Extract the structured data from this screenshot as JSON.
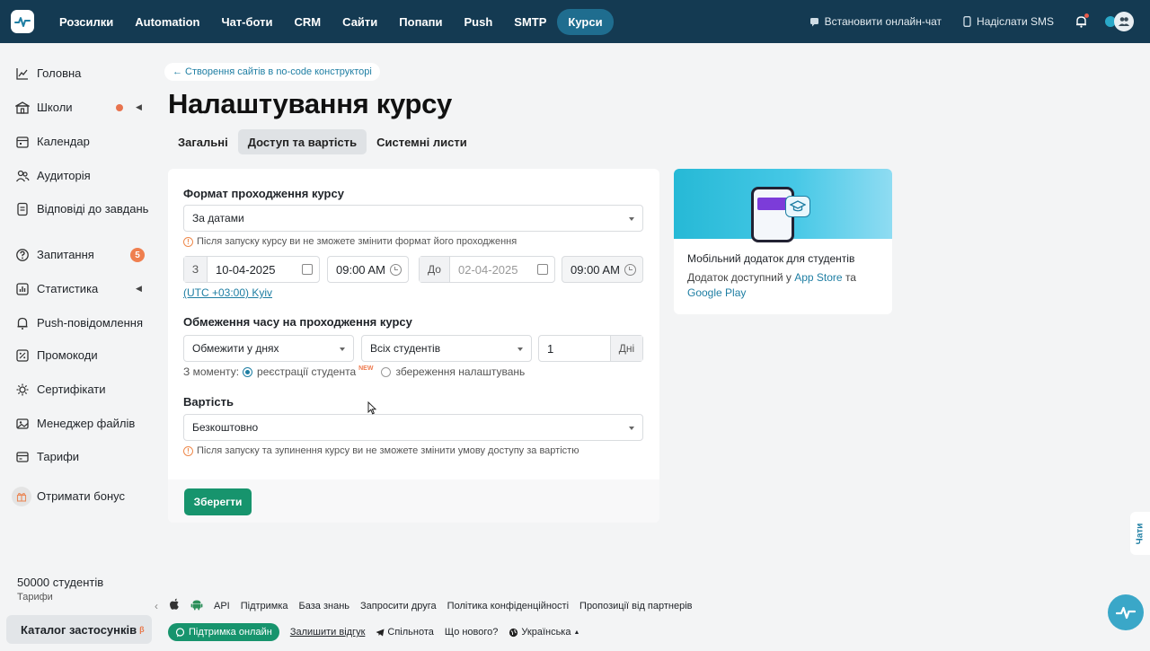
{
  "topnav": {
    "items": [
      "Розсилки",
      "Automation",
      "Чат-боти",
      "CRM",
      "Сайти",
      "Попапи",
      "Push",
      "SMTP",
      "Курси"
    ],
    "active": "Курси",
    "install_chat": "Встановити онлайн-чат",
    "send_sms": "Надіслати SMS"
  },
  "sidebar": {
    "items": [
      {
        "label": "Головна",
        "icon": "chart-line-icon"
      },
      {
        "label": "Школи",
        "icon": "school-icon"
      },
      {
        "label": "Календар",
        "icon": "calendar-icon"
      },
      {
        "label": "Аудиторія",
        "icon": "users-icon"
      },
      {
        "label": "Відповіді до завдань",
        "icon": "answers-icon"
      },
      {
        "label": "Запитання",
        "icon": "question-icon",
        "badge": "5"
      },
      {
        "label": "Статистика",
        "icon": "stats-icon"
      },
      {
        "label": "Push-повідомлення",
        "icon": "bell-icon"
      },
      {
        "label": "Промокоди",
        "icon": "promo-icon"
      },
      {
        "label": "Сертифікати",
        "icon": "certificate-icon"
      },
      {
        "label": "Менеджер файлів",
        "icon": "files-icon"
      },
      {
        "label": "Тарифи",
        "icon": "tariff-icon"
      },
      {
        "label": "Отримати бонус",
        "icon": "gift-icon"
      }
    ],
    "students": "50000 студентів",
    "tariffs_link": "Тарифи",
    "catalog": "Каталог застосунків",
    "catalog_badge": "β"
  },
  "breadcrumb": "← Створення сайтів в no-code конструкторі",
  "page_title": "Налаштування курсу",
  "tabs": [
    "Загальні",
    "Доступ та вартість",
    "Системні листи"
  ],
  "active_tab": "Доступ та вартість",
  "form": {
    "format_label": "Формат проходження курсу",
    "format_value": "За датами",
    "format_hint": "Після запуску курсу ви не зможете змінити формат його проходження",
    "from_label": "З",
    "from_date": "10-04-2025",
    "from_time": "09:00 AM",
    "to_label": "До",
    "to_date": "02-04-2025",
    "to_time": "09:00 AM",
    "timezone": "(UTC +03:00) Kyiv",
    "limit_label": "Обмеження часу на проходження курсу",
    "limit_type": "Обмежити у днях",
    "limit_scope": "Всіх студентів",
    "limit_count": "1",
    "limit_unit": "Дні",
    "moment_label": "З моменту:",
    "moment_opt1": "реєстрації студента",
    "moment_opt1_tag": "NEW",
    "moment_opt2": "збереження налаштувань",
    "price_label": "Вартість",
    "price_value": "Безкоштовно",
    "price_hint": "Після запуску та зупинення курсу ви не зможете змінити умову доступу за вартістю",
    "save": "Зберегти"
  },
  "promo": {
    "title": "Мобільний додаток для студентів",
    "text_prefix": "Додаток доступний у",
    "app_store": "App Store",
    "and": "та",
    "google_play": "Google Play"
  },
  "footer": {
    "links1": [
      "API",
      "Підтримка",
      "База знань",
      "Запросити друга",
      "Політика конфіденційності",
      "Пропозиції від партнерів"
    ],
    "support_online": "Підтримка онлайн",
    "feedback": "Залишити відгук",
    "community": "Спільнота",
    "whats_new": "Що нового?",
    "language": "Українська"
  },
  "chats_tab": "Чати"
}
